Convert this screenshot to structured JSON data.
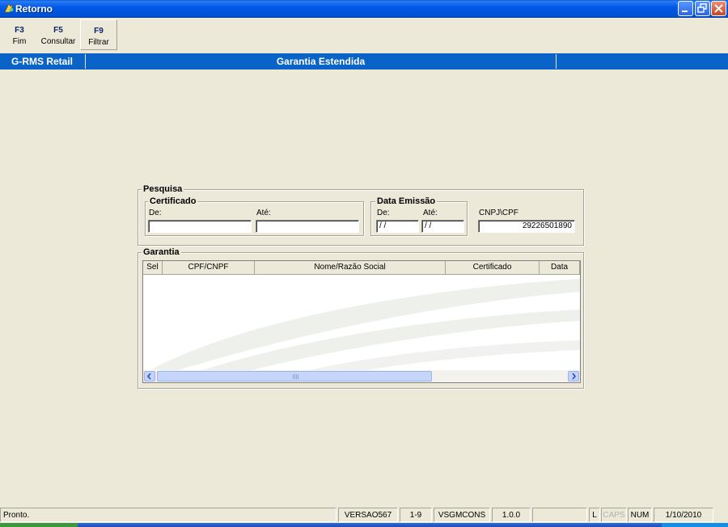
{
  "window": {
    "title": "Retorno",
    "buttons": {
      "minimize_icon": "minimize-icon",
      "restore_icon": "restore-icon",
      "close_icon": "close-icon"
    }
  },
  "toolbar": [
    {
      "key": "F3",
      "label": "Fim"
    },
    {
      "key": "F5",
      "label": "Consultar"
    },
    {
      "key": "F9",
      "label": "Filtrar"
    }
  ],
  "header": {
    "brand": "G-RMS Retail",
    "title": "Garantia Estendida"
  },
  "search": {
    "title": "Pesquisa",
    "certificado": {
      "title": "Certificado",
      "de_label": "De:",
      "de_value": "",
      "ate_label": "Até:",
      "ate_value": ""
    },
    "data_emissao": {
      "title": "Data Emissão",
      "de_label": "De:",
      "de_value": "/ /",
      "ate_label": "Até:",
      "ate_value": "/ /"
    },
    "cnpj_label": "CNPJ\\CPF",
    "cnpj_value": "29226501890"
  },
  "garantia": {
    "title": "Garantia",
    "columns": [
      "Sel",
      "CPF/CNPF",
      "Nome/Razão Social",
      "Certificado",
      "Data"
    ],
    "rows": []
  },
  "statusbar": {
    "message": "Pronto.",
    "version_name": "VERSAO567",
    "range": "1-9",
    "user": "VSGMCONS",
    "version": "1.0.0",
    "empty": "",
    "l": "L",
    "caps": "CAPS",
    "num": "NUM",
    "date": "1/10/2010"
  },
  "colors": {
    "titlebar": "#0058e6",
    "header_band": "#0a64c8",
    "window_bg": "#ece9d8",
    "toolbar_key": "#0a246a"
  }
}
